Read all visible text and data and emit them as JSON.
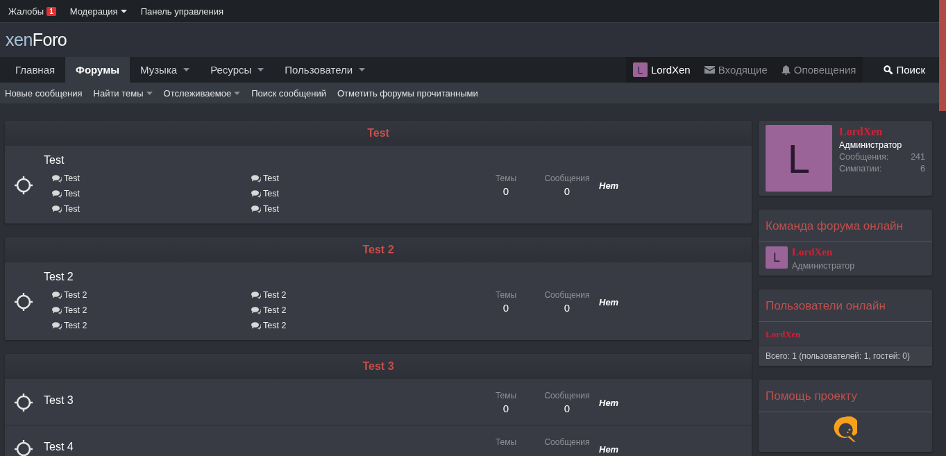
{
  "staff_bar": [
    {
      "label": "Жалобы",
      "kind": "link",
      "badge": "1"
    },
    {
      "label": "Модерация",
      "kind": "dropdown"
    },
    {
      "label": "Панель управления",
      "kind": "link"
    }
  ],
  "logo": {
    "part1": "xen",
    "part2": "Foro"
  },
  "nav_tabs": [
    {
      "label": "Главная",
      "selected": false,
      "has_menu": false
    },
    {
      "label": "Форумы",
      "selected": true,
      "has_menu": false
    },
    {
      "label": "Музыка",
      "selected": false,
      "has_menu": true
    },
    {
      "label": "Ресурсы",
      "selected": false,
      "has_menu": true
    },
    {
      "label": "Пользователи",
      "selected": false,
      "has_menu": true
    }
  ],
  "user_nav": {
    "avatar_letter": "L",
    "username": "LordXen",
    "inbox": "Входящие",
    "alerts": "Оповещения",
    "search": "Поиск"
  },
  "sub_nav": [
    {
      "label": "Новые сообщения",
      "has_menu": false
    },
    {
      "label": "Найти темы",
      "has_menu": true
    },
    {
      "label": "Отслеживаемое",
      "has_menu": true
    },
    {
      "label": "Поиск сообщений",
      "has_menu": false
    },
    {
      "label": "Отметить форумы прочитанными",
      "has_menu": false
    }
  ],
  "categories": [
    {
      "title": "Test",
      "forums": [
        {
          "title": "Test",
          "subforums": [
            "Test",
            "Test",
            "Test",
            "Test",
            "Test",
            "Test"
          ],
          "stats": [
            {
              "label": "Темы",
              "value": "0"
            },
            {
              "label": "Сообщения",
              "value": "0"
            }
          ],
          "last_post": "Нет"
        }
      ]
    },
    {
      "title": "Test 2",
      "forums": [
        {
          "title": "Test 2",
          "subforums": [
            "Test 2",
            "Test 2",
            "Test 2",
            "Test 2",
            "Test 2",
            "Test 2"
          ],
          "stats": [
            {
              "label": "Темы",
              "value": "0"
            },
            {
              "label": "Сообщения",
              "value": "0"
            }
          ],
          "last_post": "Нет"
        }
      ]
    },
    {
      "title": "Test 3",
      "forums": [
        {
          "title": "Test 3",
          "stats": [
            {
              "label": "Темы",
              "value": "0"
            },
            {
              "label": "Сообщения",
              "value": "0"
            }
          ],
          "last_post": "Нет"
        },
        {
          "title": "Test 4",
          "stats": [
            {
              "label": "Темы"
            },
            {
              "label": "Сообщения"
            }
          ],
          "last_post": "Нет"
        }
      ]
    }
  ],
  "sidebar": {
    "visitor": {
      "avatar_letter": "L",
      "username": "LordXen",
      "role": "Администратор",
      "stats": [
        {
          "label": "Сообщения:",
          "value": "241"
        },
        {
          "label": "Симпатии:",
          "value": "6"
        }
      ]
    },
    "staff_online": {
      "title": "Команда форума онлайн",
      "members": [
        {
          "avatar_letter": "L",
          "username": "LordXen",
          "role": "Администратор"
        }
      ]
    },
    "members_online": {
      "title": "Пользователи онлайн",
      "members": [
        "LordXen"
      ],
      "footer": "Всего: 1 (пользователей: 1, гостей: 0)"
    },
    "donate": {
      "title": "Помощь проекту"
    }
  }
}
